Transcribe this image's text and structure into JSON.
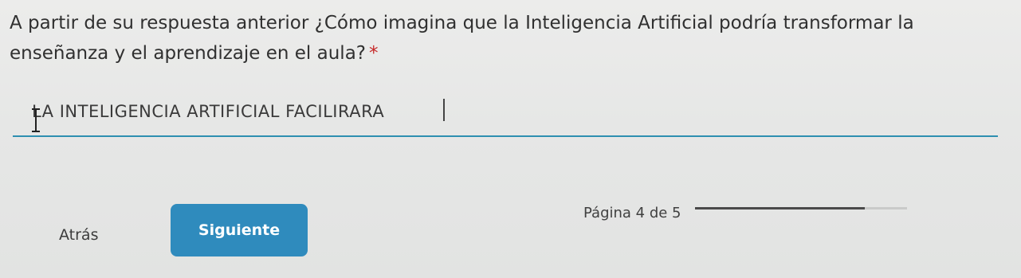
{
  "question": {
    "text": "A partir de su respuesta anterior ¿Cómo imagina que la Inteligencia Artificial podría transformar la enseñanza y el aprendizaje en el aula?",
    "required_mark": "*"
  },
  "answer": {
    "value": "LA INTELIGENCIA ARTIFICIAL FACILIRARA"
  },
  "navigation": {
    "back_label": "Atrás",
    "next_label": "Siguiente"
  },
  "pagination": {
    "label": "Página 4 de 5",
    "current": 4,
    "total": 5,
    "progress_fraction": 0.8
  },
  "colors": {
    "accent": "#2f8bbd",
    "input_underline": "#2e8fb0",
    "required": "#c62828"
  },
  "icons": {
    "text_cursor": "i-beam-cursor-icon"
  }
}
